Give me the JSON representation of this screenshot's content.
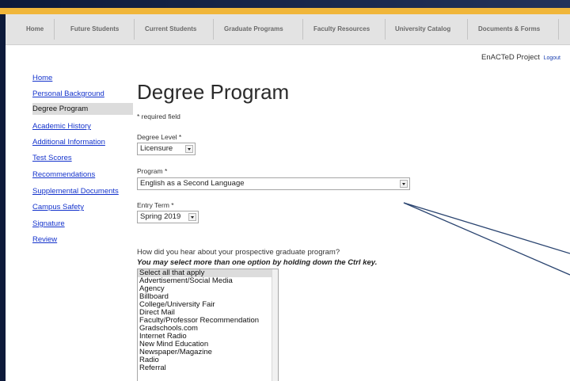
{
  "top_nav": [
    {
      "label": "Home"
    },
    {
      "label": "Future Students"
    },
    {
      "label": "Current Students"
    },
    {
      "label": "Graduate Programs"
    },
    {
      "label": "Faculty Resources"
    },
    {
      "label": "University Catalog"
    },
    {
      "label": "Documents & Forms"
    }
  ],
  "header": {
    "project": "EnACTeD Project",
    "logout": "Logout"
  },
  "sidebar": [
    {
      "label": "Home",
      "active": false
    },
    {
      "label": "Personal Background",
      "active": false
    },
    {
      "label": "Degree Program",
      "active": true
    },
    {
      "label": "Academic History",
      "active": false
    },
    {
      "label": "Additional Information",
      "active": false
    },
    {
      "label": "Test Scores",
      "active": false
    },
    {
      "label": "Recommendations",
      "active": false
    },
    {
      "label": "Supplemental Documents",
      "active": false
    },
    {
      "label": "Campus Safety",
      "active": false
    },
    {
      "label": "Signature",
      "active": false
    },
    {
      "label": "Review",
      "active": false
    }
  ],
  "page": {
    "title": "Degree Program",
    "required_note": "* required field"
  },
  "form": {
    "degree_level": {
      "label": "Degree Level *",
      "value": "Licensure"
    },
    "program": {
      "label": "Program *",
      "value": "English as a Second Language"
    },
    "entry_term": {
      "label": "Entry Term *",
      "value": "Spring 2019"
    },
    "question": "How did you hear about your prospective graduate program?",
    "hint": "You may select more than one option by holding down the Ctrl key.",
    "options": [
      "Select all that apply",
      "Advertisement/Social Media",
      "Agency",
      "Billboard",
      "College/University Fair",
      "Direct Mail",
      "Faculty/Professor Recommendation",
      "Gradschools.com",
      "Internet Radio",
      "New Mind Education",
      "Newspaper/Magazine",
      "Radio",
      "Referral"
    ]
  },
  "colors": {
    "accent_bar": "#f0b63a",
    "link": "#1433cc",
    "nav_bg": "#e3e3e3"
  }
}
